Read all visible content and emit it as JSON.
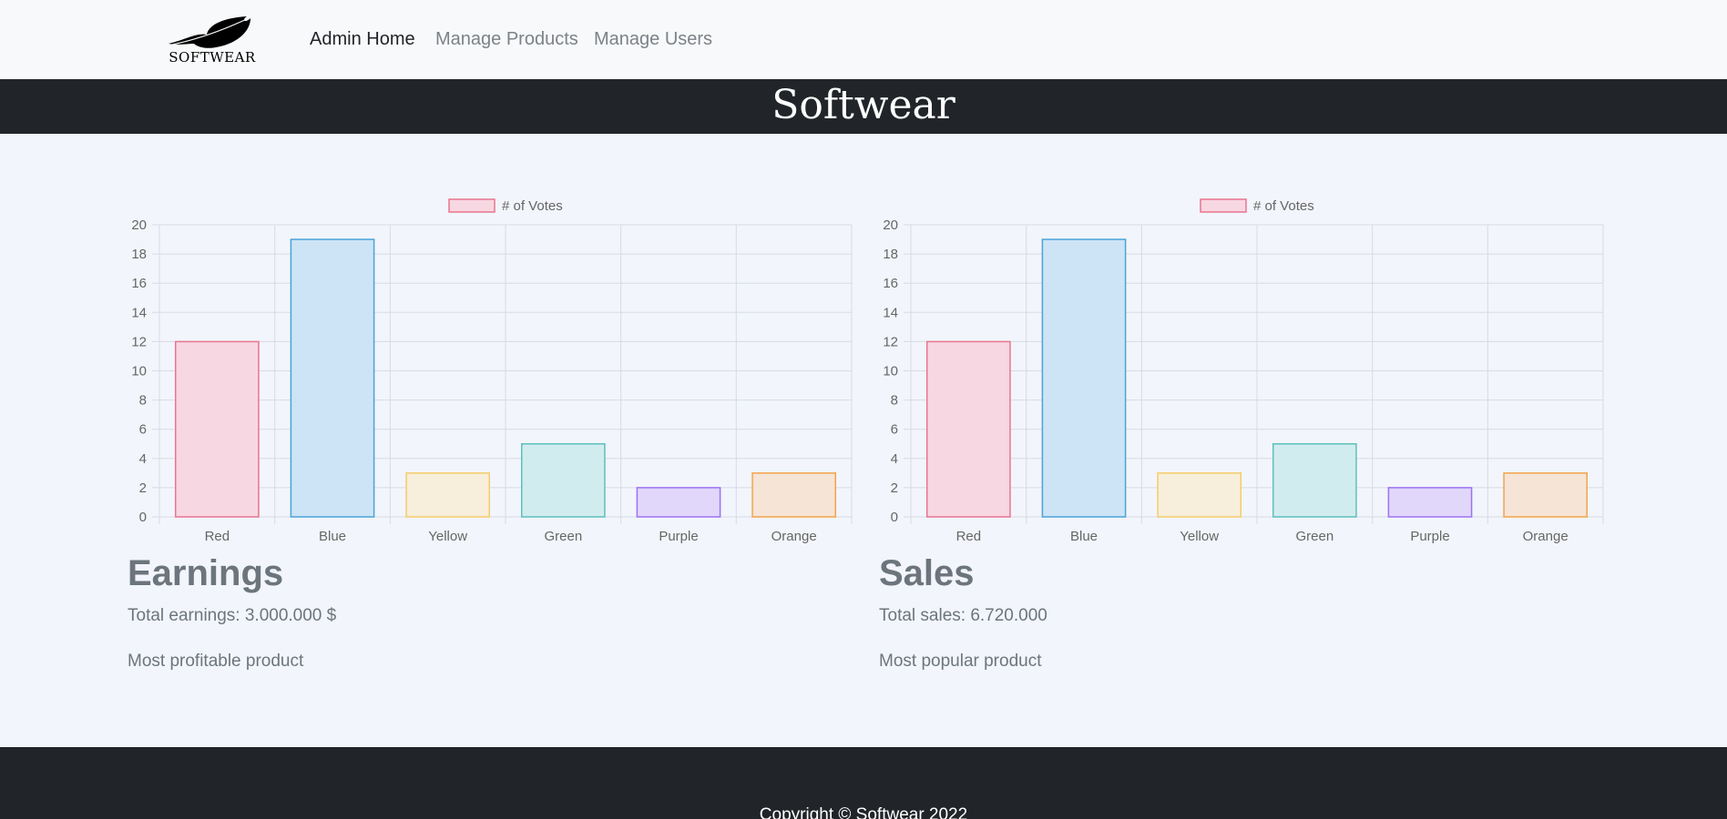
{
  "navbar": {
    "logo_text": "SOFTWEAR",
    "links": [
      {
        "label": "Admin Home",
        "active": true
      },
      {
        "label": "Manage Products",
        "active": false
      },
      {
        "label": "Manage Users",
        "active": false
      }
    ]
  },
  "banner": {
    "title": "Softwear"
  },
  "chart_data": [
    {
      "type": "bar",
      "categories": [
        "Red",
        "Blue",
        "Yellow",
        "Green",
        "Purple",
        "Orange"
      ],
      "series": [
        {
          "name": "# of Votes",
          "values": [
            12,
            19,
            3,
            5,
            2,
            3
          ]
        }
      ],
      "ylim": [
        0,
        20
      ],
      "yticks": [
        0,
        2,
        4,
        6,
        8,
        10,
        12,
        14,
        16,
        18,
        20
      ],
      "grid": true,
      "legend_position": "top",
      "colors": {
        "fills": [
          "#f7d7e2",
          "#cde3f6",
          "#f7efdb",
          "#d1ecef",
          "#e1d7fb",
          "#f6e4d7"
        ],
        "borders": [
          "#e9758f",
          "#4aa3d8",
          "#f5cc6a",
          "#5cc0bd",
          "#9c72f0",
          "#f2a44a"
        ]
      }
    },
    {
      "type": "bar",
      "categories": [
        "Red",
        "Blue",
        "Yellow",
        "Green",
        "Purple",
        "Orange"
      ],
      "series": [
        {
          "name": "# of Votes",
          "values": [
            12,
            19,
            3,
            5,
            2,
            3
          ]
        }
      ],
      "ylim": [
        0,
        20
      ],
      "yticks": [
        0,
        2,
        4,
        6,
        8,
        10,
        12,
        14,
        16,
        18,
        20
      ],
      "grid": true,
      "legend_position": "top",
      "colors": {
        "fills": [
          "#f7d7e2",
          "#cde3f6",
          "#f7efdb",
          "#d1ecef",
          "#e1d7fb",
          "#f6e4d7"
        ],
        "borders": [
          "#e9758f",
          "#4aa3d8",
          "#f5cc6a",
          "#5cc0bd",
          "#9c72f0",
          "#f2a44a"
        ]
      }
    }
  ],
  "earnings": {
    "title": "Earnings",
    "total": "Total earnings: 3.000.000 $",
    "subtitle": "Most profitable product"
  },
  "sales": {
    "title": "Sales",
    "total": "Total sales: 6.720.000",
    "subtitle": "Most popular product"
  },
  "footer": {
    "copyright": "Copyright © Softwear 2022"
  },
  "colors": {
    "dark": "#212529",
    "page_bg": "#f2f5fb",
    "navbar_bg": "#f8f9fa"
  }
}
